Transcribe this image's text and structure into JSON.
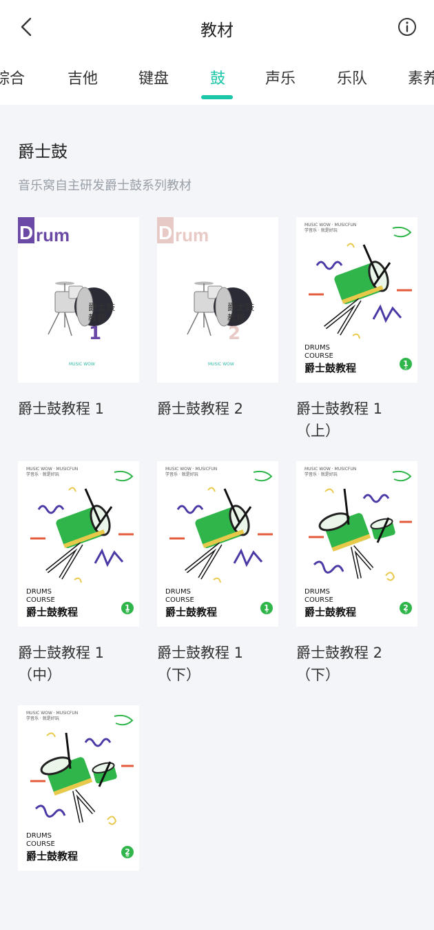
{
  "header": {
    "title": "教材"
  },
  "tabs": [
    {
      "label": "综合",
      "active": false
    },
    {
      "label": "吉他",
      "active": false
    },
    {
      "label": "键盘",
      "active": false
    },
    {
      "label": "鼓",
      "active": true
    },
    {
      "label": "声乐",
      "active": false
    },
    {
      "label": "乐队",
      "active": false
    },
    {
      "label": "素养",
      "active": false
    }
  ],
  "section": {
    "title": "爵士鼓",
    "subtitle": "音乐窝自主研发爵士鼓系列教材"
  },
  "books": [
    {
      "label": "爵士鼓教程 1",
      "cover": {
        "type": "drum",
        "word": "Drum",
        "cn": "爵士鼓教程",
        "num": "1",
        "accent": "#6b4aa6",
        "num_color": "#6b4aa6"
      }
    },
    {
      "label": "爵士鼓教程 2",
      "cover": {
        "type": "drum",
        "word": "Drum",
        "cn": "爵士鼓教程",
        "num": "2",
        "accent": "#e7c9c6",
        "num_color": "#e7c9c6"
      }
    },
    {
      "label": "爵士鼓教程 1（上）",
      "cover": {
        "type": "course",
        "en": "DRUMS\nCOURSE",
        "cn": "爵士鼓教程",
        "badge": "1",
        "badge_sub": "上"
      }
    },
    {
      "label": "爵士鼓教程 1（中）",
      "cover": {
        "type": "course",
        "en": "DRUMS\nCOURSE",
        "cn": "爵士鼓教程",
        "badge": "1",
        "badge_sub": "中"
      }
    },
    {
      "label": "爵士鼓教程 1（下）",
      "cover": {
        "type": "course",
        "en": "DRUMS\nCOURSE",
        "cn": "爵士鼓教程",
        "badge": "1",
        "badge_sub": "下"
      }
    },
    {
      "label": "爵士鼓教程 2（下）",
      "cover": {
        "type": "course2",
        "en": "DRUMS\nCOURSE",
        "cn": "爵士鼓教程",
        "badge": "2",
        "badge_sub": "下"
      }
    },
    {
      "label": "",
      "cover": {
        "type": "course2",
        "en": "DRUMS\nCOURSE",
        "cn": "爵士鼓教程",
        "badge": "2",
        "badge_sub": "中"
      }
    }
  ],
  "colors": {
    "accent": "#1cc6a8",
    "green": "#2fb54a",
    "purple": "#4b3aa6",
    "yellow": "#e9c94a",
    "red": "#e35a3a"
  },
  "course_top_text": "MUSIC WOW · MUSICFUN\n学音乐 · 就是好玩",
  "brand_tiny": "MUSIC WOW"
}
